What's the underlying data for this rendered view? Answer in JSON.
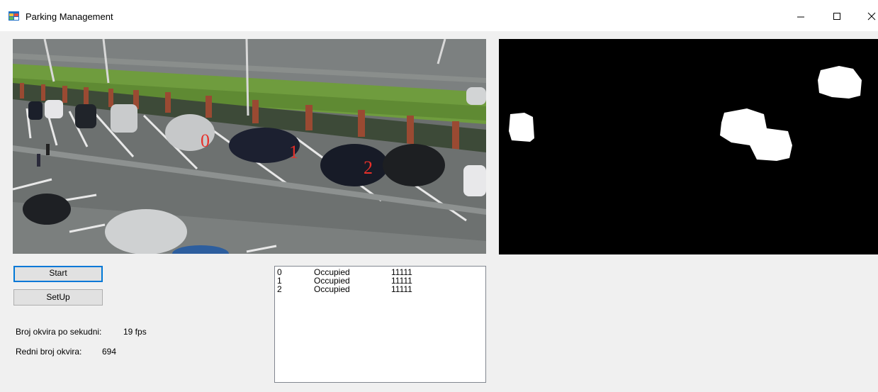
{
  "window": {
    "title": "Parking Management",
    "icon": "app-window-icon"
  },
  "controls": {
    "start_label": "Start",
    "setup_label": "SetUp"
  },
  "stats": {
    "fps_label": "Broj okvira po sekudni:",
    "fps_value": "19 fps",
    "frame_label": "Redni broj okvira:",
    "frame_value": "694"
  },
  "spots_list": [
    {
      "id": "0",
      "status": "Occupied",
      "code": "11111"
    },
    {
      "id": "1",
      "status": "Occupied",
      "code": "11111"
    },
    {
      "id": "2",
      "status": "Occupied",
      "code": "11111"
    }
  ],
  "video_overlay": {
    "spot_labels": [
      "0",
      "1",
      "2"
    ],
    "label_color": "#e8302a"
  },
  "colors": {
    "focus_border": "#0078d7",
    "window_bg": "#f0f0f0"
  }
}
